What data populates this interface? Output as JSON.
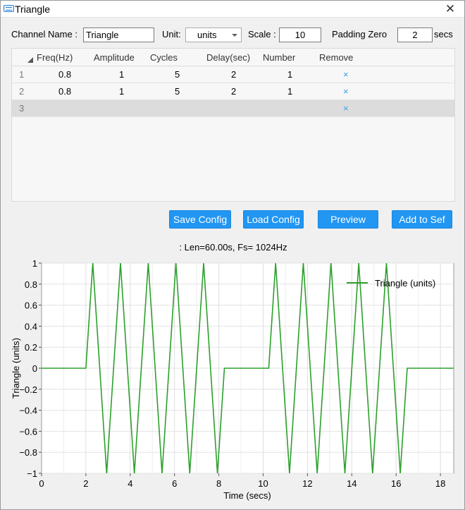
{
  "window": {
    "title": "Triangle"
  },
  "controls": {
    "channel_name_label": "Channel Name :",
    "channel_name_value": "Triangle",
    "unit_label": "Unit:",
    "unit_value": "units",
    "scale_label": "Scale :",
    "scale_value": "10",
    "padding_label": "Padding Zero",
    "padding_value": "2",
    "padding_unit": "secs"
  },
  "table": {
    "columns": [
      "Freq(Hz)",
      "Amplitude",
      "Cycles",
      "Delay(sec)",
      "Number",
      "Remove"
    ],
    "rows": [
      {
        "num": "1",
        "freq": "0.8",
        "amplitude": "1",
        "cycles": "5",
        "delay": "2",
        "number": "1",
        "remove": "×"
      },
      {
        "num": "2",
        "freq": "0.8",
        "amplitude": "1",
        "cycles": "5",
        "delay": "2",
        "number": "1",
        "remove": "×"
      },
      {
        "num": "3",
        "freq": "",
        "amplitude": "",
        "cycles": "",
        "delay": "",
        "number": "",
        "remove": "×"
      }
    ]
  },
  "buttons": {
    "save_config": "Save Config",
    "load_config": "Load Config",
    "preview": "Preview",
    "add_to_sef": "Add to Sef"
  },
  "plot_info": ": Len=60.00s, Fs= 1024Hz",
  "icons": {
    "close": "close-icon",
    "app": "app-icon",
    "dropdown": "chevron-down-icon",
    "remove": "remove-x-icon"
  },
  "colors": {
    "series": "#2ca02c",
    "button": "#2196f3",
    "remove": "#3ba0e6"
  },
  "chart_data": {
    "type": "line",
    "xlabel": "Time (secs)",
    "ylabel": "Triangle (units)",
    "xlim": [
      0,
      18.6
    ],
    "ylim": [
      -1,
      1
    ],
    "xticks": [
      "0",
      "2",
      "4",
      "6",
      "8",
      "10",
      "12",
      "14",
      "16",
      "18"
    ],
    "yticks": [
      "-1",
      "-0.8",
      "-0.6",
      "-0.4",
      "-0.2",
      "0",
      "0.2",
      "0.4",
      "0.6",
      "0.8",
      "1"
    ],
    "grid": true,
    "legend_position": "top-right",
    "series": [
      {
        "name": "Triangle (units)",
        "color": "#2ca02c",
        "x": [
          0,
          2,
          2.3125,
          2.9375,
          3.5625,
          4.1875,
          4.8125,
          5.4375,
          6.0625,
          6.6875,
          7.3125,
          7.9375,
          8.25,
          10.25,
          10.5625,
          11.1875,
          11.8125,
          12.4375,
          13.0625,
          13.6875,
          14.3125,
          14.9375,
          15.5625,
          16.1875,
          16.5,
          18.6
        ],
        "y": [
          0,
          0,
          1,
          -1,
          1,
          -1,
          1,
          -1,
          1,
          -1,
          1,
          -1,
          0,
          0,
          1,
          -1,
          1,
          -1,
          1,
          -1,
          1,
          -1,
          1,
          -1,
          0,
          0
        ]
      }
    ]
  }
}
